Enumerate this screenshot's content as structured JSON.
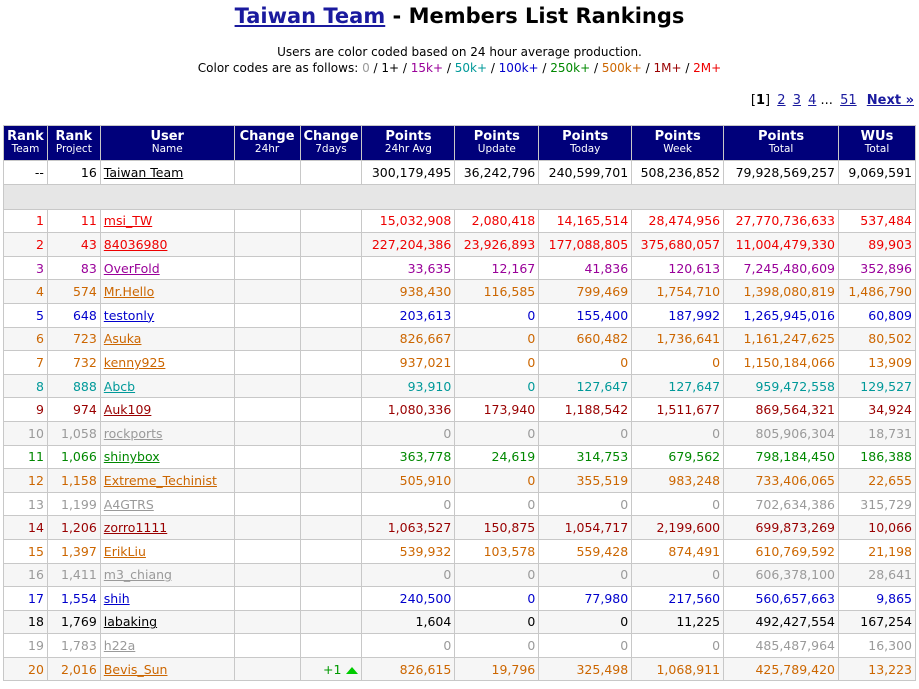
{
  "header": {
    "team_name": "Taiwan Team",
    "title_suffix": " - Members List Rankings",
    "line1": "Users are color coded based on 24 hour average production.",
    "line2_prefix": "Color codes are as follows:",
    "codes": [
      {
        "label": "0",
        "color": "#9a9a9a"
      },
      {
        "label": "1+",
        "color": "#000000"
      },
      {
        "label": "15k+",
        "color": "#990099"
      },
      {
        "label": "50k+",
        "color": "#009999"
      },
      {
        "label": "100k+",
        "color": "#0000cc"
      },
      {
        "label": "250k+",
        "color": "#008800"
      },
      {
        "label": "500k+",
        "color": "#cc6600"
      },
      {
        "label": "1M+",
        "color": "#990000"
      },
      {
        "label": "2M+",
        "color": "#ee0000"
      }
    ]
  },
  "pager": {
    "current": "1",
    "pages": [
      "2",
      "3",
      "4"
    ],
    "ellipsis": "...",
    "last": "51",
    "next": "Next »"
  },
  "columns": [
    {
      "top": "Rank",
      "bottom": "Team"
    },
    {
      "top": "Rank",
      "bottom": "Project"
    },
    {
      "top": "User",
      "bottom": "Name"
    },
    {
      "top": "Change",
      "bottom": "24hr"
    },
    {
      "top": "Change",
      "bottom": "7days"
    },
    {
      "top": "Points",
      "bottom": "24hr Avg"
    },
    {
      "top": "Points",
      "bottom": "Update"
    },
    {
      "top": "Points",
      "bottom": "Today"
    },
    {
      "top": "Points",
      "bottom": "Week"
    },
    {
      "top": "Points",
      "bottom": "Total"
    },
    {
      "top": "WUs",
      "bottom": "Total"
    }
  ],
  "team_row": {
    "rank_team": "--",
    "rank_project": "16",
    "name": "Taiwan Team",
    "change24": "",
    "change7": "",
    "avg": "300,179,495",
    "update": "36,242,796",
    "today": "240,599,701",
    "week": "508,236,852",
    "total": "79,928,569,257",
    "wus": "9,069,591"
  },
  "rows": [
    {
      "rank_team": "1",
      "rank_project": "11",
      "name": "msi_TW",
      "change24": "",
      "change7": "",
      "avg": "15,032,908",
      "update": "2,080,418",
      "today": "14,165,514",
      "week": "28,474,956",
      "total": "27,770,736,633",
      "wus": "537,484",
      "cls": "c2m"
    },
    {
      "rank_team": "2",
      "rank_project": "43",
      "name": "84036980",
      "change24": "",
      "change7": "",
      "avg": "227,204,386",
      "update": "23,926,893",
      "today": "177,088,805",
      "week": "375,680,057",
      "total": "11,004,479,330",
      "wus": "89,903",
      "cls": "c2m"
    },
    {
      "rank_team": "3",
      "rank_project": "83",
      "name": "OverFold",
      "change24": "",
      "change7": "",
      "avg": "33,635",
      "update": "12,167",
      "today": "41,836",
      "week": "120,613",
      "total": "7,245,480,609",
      "wus": "352,896",
      "cls": "c15"
    },
    {
      "rank_team": "4",
      "rank_project": "574",
      "name": "Mr.Hello",
      "change24": "",
      "change7": "",
      "avg": "938,430",
      "update": "116,585",
      "today": "799,469",
      "week": "1,754,710",
      "total": "1,398,080,819",
      "wus": "1,486,790",
      "cls": "c500"
    },
    {
      "rank_team": "5",
      "rank_project": "648",
      "name": "testonly",
      "change24": "",
      "change7": "",
      "avg": "203,613",
      "update": "0",
      "today": "155,400",
      "week": "187,992",
      "total": "1,265,945,016",
      "wus": "60,809",
      "cls": "c100"
    },
    {
      "rank_team": "6",
      "rank_project": "723",
      "name": "Asuka",
      "change24": "",
      "change7": "",
      "avg": "826,667",
      "update": "0",
      "today": "660,482",
      "week": "1,736,641",
      "total": "1,161,247,625",
      "wus": "80,502",
      "cls": "c500"
    },
    {
      "rank_team": "7",
      "rank_project": "732",
      "name": "kenny925",
      "change24": "",
      "change7": "",
      "avg": "937,021",
      "update": "0",
      "today": "0",
      "week": "0",
      "total": "1,150,184,066",
      "wus": "13,909",
      "cls": "c500"
    },
    {
      "rank_team": "8",
      "rank_project": "888",
      "name": "Abcb",
      "change24": "",
      "change7": "",
      "avg": "93,910",
      "update": "0",
      "today": "127,647",
      "week": "127,647",
      "total": "959,472,558",
      "wus": "129,527",
      "cls": "c50"
    },
    {
      "rank_team": "9",
      "rank_project": "974",
      "name": "Auk109",
      "change24": "",
      "change7": "",
      "avg": "1,080,336",
      "update": "173,940",
      "today": "1,188,542",
      "week": "1,511,677",
      "total": "869,564,321",
      "wus": "34,924",
      "cls": "c1m"
    },
    {
      "rank_team": "10",
      "rank_project": "1,058",
      "name": "rockports",
      "change24": "",
      "change7": "",
      "avg": "0",
      "update": "0",
      "today": "0",
      "week": "0",
      "total": "805,906,304",
      "wus": "18,731",
      "cls": "c0"
    },
    {
      "rank_team": "11",
      "rank_project": "1,066",
      "name": "shinybox",
      "change24": "",
      "change7": "",
      "avg": "363,778",
      "update": "24,619",
      "today": "314,753",
      "week": "679,562",
      "total": "798,184,450",
      "wus": "186,388",
      "cls": "c250"
    },
    {
      "rank_team": "12",
      "rank_project": "1,158",
      "name": "Extreme_Techinist",
      "change24": "",
      "change7": "",
      "avg": "505,910",
      "update": "0",
      "today": "355,519",
      "week": "983,248",
      "total": "733,406,065",
      "wus": "22,655",
      "cls": "c500"
    },
    {
      "rank_team": "13",
      "rank_project": "1,199",
      "name": "A4GTRS",
      "change24": "",
      "change7": "",
      "avg": "0",
      "update": "0",
      "today": "0",
      "week": "0",
      "total": "702,634,386",
      "wus": "315,729",
      "cls": "c0"
    },
    {
      "rank_team": "14",
      "rank_project": "1,206",
      "name": "zorro1111",
      "change24": "",
      "change7": "",
      "avg": "1,063,527",
      "update": "150,875",
      "today": "1,054,717",
      "week": "2,199,600",
      "total": "699,873,269",
      "wus": "10,066",
      "cls": "c1m"
    },
    {
      "rank_team": "15",
      "rank_project": "1,397",
      "name": "ErikLiu",
      "change24": "",
      "change7": "",
      "avg": "539,932",
      "update": "103,578",
      "today": "559,428",
      "week": "874,491",
      "total": "610,769,592",
      "wus": "21,198",
      "cls": "c500"
    },
    {
      "rank_team": "16",
      "rank_project": "1,411",
      "name": "m3_chiang",
      "change24": "",
      "change7": "",
      "avg": "0",
      "update": "0",
      "today": "0",
      "week": "0",
      "total": "606,378,100",
      "wus": "28,641",
      "cls": "c0"
    },
    {
      "rank_team": "17",
      "rank_project": "1,554",
      "name": "shih",
      "change24": "",
      "change7": "",
      "avg": "240,500",
      "update": "0",
      "today": "77,980",
      "week": "217,560",
      "total": "560,657,663",
      "wus": "9,865",
      "cls": "c100"
    },
    {
      "rank_team": "18",
      "rank_project": "1,769",
      "name": "labaking",
      "change24": "",
      "change7": "",
      "avg": "1,604",
      "update": "0",
      "today": "0",
      "week": "11,225",
      "total": "492,427,554",
      "wus": "167,254",
      "cls": "c1"
    },
    {
      "rank_team": "19",
      "rank_project": "1,783",
      "name": "h22a",
      "change24": "",
      "change7": "",
      "avg": "0",
      "update": "0",
      "today": "0",
      "week": "0",
      "total": "485,487,964",
      "wus": "16,300",
      "cls": "c0"
    },
    {
      "rank_team": "20",
      "rank_project": "2,016",
      "name": "Bevis_Sun",
      "change24": "",
      "change7": "+1",
      "change7_icon": "up-arrow-icon",
      "avg": "826,615",
      "update": "19,796",
      "today": "325,498",
      "week": "1,068,911",
      "total": "425,789,420",
      "wus": "13,223",
      "cls": "c500"
    }
  ]
}
